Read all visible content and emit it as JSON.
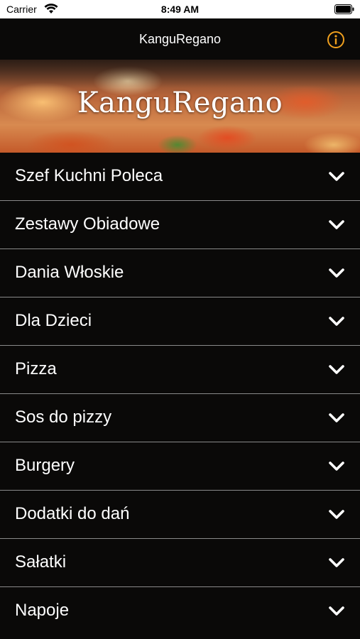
{
  "status_bar": {
    "carrier": "Carrier",
    "time": "8:49 AM",
    "wifi_icon": "wifi-icon",
    "battery_icon": "battery-icon"
  },
  "nav_bar": {
    "title": "KanguRegano",
    "info_icon": "info-icon",
    "accent_color": "#f0a01e"
  },
  "hero": {
    "logo_text": "KanguRegano"
  },
  "menu": {
    "items": [
      {
        "label": "Szef Kuchni Poleca"
      },
      {
        "label": "Zestawy Obiadowe"
      },
      {
        "label": "Dania Włoskie"
      },
      {
        "label": "Dla Dzieci"
      },
      {
        "label": "Pizza"
      },
      {
        "label": "Sos do pizzy"
      },
      {
        "label": "Burgery"
      },
      {
        "label": "Dodatki do dań"
      },
      {
        "label": "Sałatki"
      },
      {
        "label": "Napoje"
      }
    ],
    "expand_icon": "chevron-down-icon"
  },
  "colors": {
    "background": "#0a0908",
    "divider": "#8a8a8a",
    "text": "#ffffff"
  }
}
